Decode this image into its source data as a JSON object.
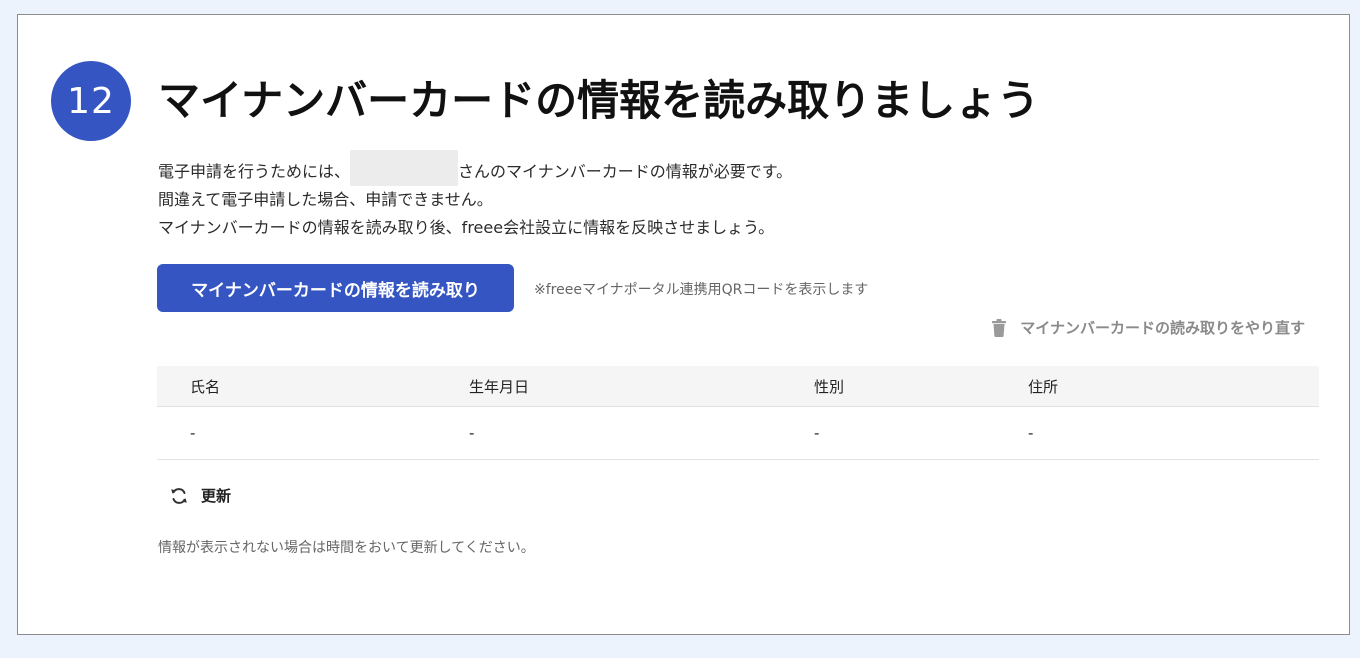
{
  "step": {
    "number": "12",
    "title": "マイナンバーカードの情報を読み取りましょう"
  },
  "description": {
    "line1_before": "電子申請を行うためには、",
    "line1_after": "さんのマイナンバーカードの情報が必要です。",
    "line2": "間違えて電子申請した場合、申請できません。",
    "line3": "マイナンバーカードの情報を読み取り後、freee会社設立に情報を反映させましょう。"
  },
  "actions": {
    "read_button_label": "マイナンバーカードの情報を読み取り",
    "read_button_note": "※freeeマイナポータル連携用QRコードを表示します",
    "redo_label": "マイナンバーカードの読み取りをやり直す",
    "refresh_label": "更新"
  },
  "table": {
    "headers": [
      "氏名",
      "生年月日",
      "性別",
      "住所"
    ],
    "rows": [
      [
        "-",
        "-",
        "-",
        "-"
      ]
    ]
  },
  "footer_note": "情報が表示されない場合は時間をおいて更新してください。",
  "icons": {
    "redo": "trash-icon",
    "refresh": "refresh-icon"
  },
  "colors": {
    "accent": "#3455c2",
    "page_background": "#edf3fd",
    "muted_text": "#8a8a8a"
  }
}
